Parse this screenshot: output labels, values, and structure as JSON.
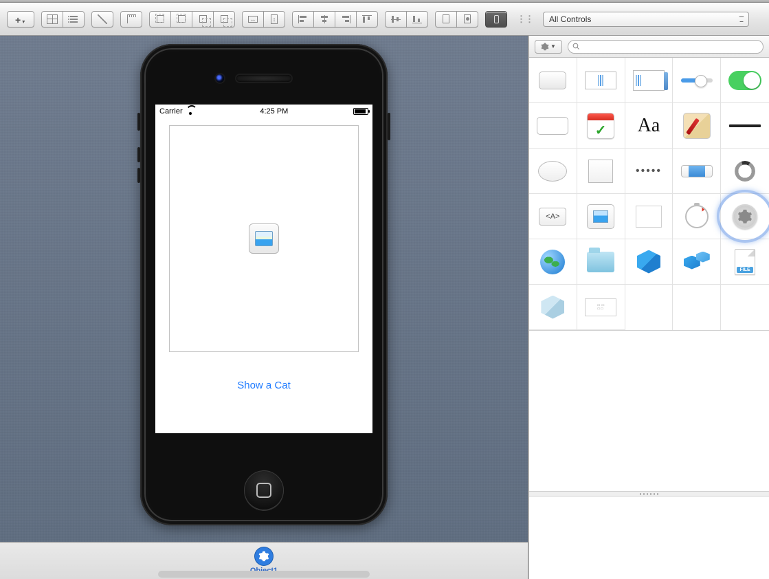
{
  "toolbar": {
    "popup_label": "All Controls"
  },
  "statusbar": {
    "carrier": "Carrier",
    "time": "4:25 PM"
  },
  "screen": {
    "button_label": "Show a Cat"
  },
  "dock": {
    "object_label": "Object1"
  },
  "panel": {
    "search_placeholder": "",
    "controls": [
      {
        "name": "button"
      },
      {
        "name": "text-field"
      },
      {
        "name": "text-view"
      },
      {
        "name": "slider"
      },
      {
        "name": "switch"
      },
      {
        "name": "segmented-control"
      },
      {
        "name": "date-picker"
      },
      {
        "name": "label",
        "text": "Aa"
      },
      {
        "name": "color-well"
      },
      {
        "name": "separator"
      },
      {
        "name": "oval"
      },
      {
        "name": "box"
      },
      {
        "name": "page-control",
        "text": "•••••"
      },
      {
        "name": "progress-bar"
      },
      {
        "name": "activity-indicator"
      },
      {
        "name": "web-view",
        "text": "<A>"
      },
      {
        "name": "image-well"
      },
      {
        "name": "table-view"
      },
      {
        "name": "timer"
      },
      {
        "name": "object-controller"
      },
      {
        "name": "web-globe"
      },
      {
        "name": "folder"
      },
      {
        "name": "cube-blue"
      },
      {
        "name": "cubes"
      },
      {
        "name": "file-template"
      },
      {
        "name": "cube-dim"
      },
      {
        "name": "nib-window"
      }
    ]
  }
}
